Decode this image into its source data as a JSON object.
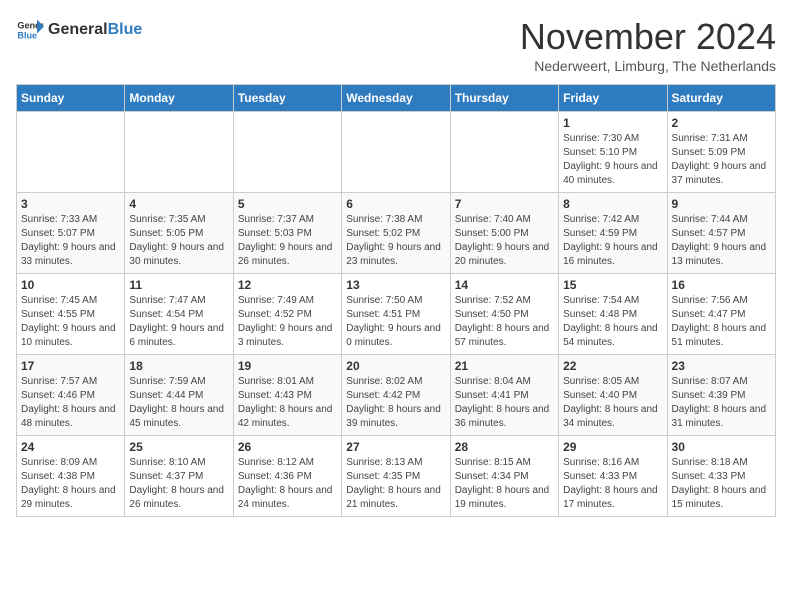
{
  "header": {
    "logo_general": "General",
    "logo_blue": "Blue",
    "month_title": "November 2024",
    "subtitle": "Nederweert, Limburg, The Netherlands"
  },
  "days_of_week": [
    "Sunday",
    "Monday",
    "Tuesday",
    "Wednesday",
    "Thursday",
    "Friday",
    "Saturday"
  ],
  "weeks": [
    [
      {
        "day": "",
        "info": ""
      },
      {
        "day": "",
        "info": ""
      },
      {
        "day": "",
        "info": ""
      },
      {
        "day": "",
        "info": ""
      },
      {
        "day": "",
        "info": ""
      },
      {
        "day": "1",
        "info": "Sunrise: 7:30 AM\nSunset: 5:10 PM\nDaylight: 9 hours and 40 minutes."
      },
      {
        "day": "2",
        "info": "Sunrise: 7:31 AM\nSunset: 5:09 PM\nDaylight: 9 hours and 37 minutes."
      }
    ],
    [
      {
        "day": "3",
        "info": "Sunrise: 7:33 AM\nSunset: 5:07 PM\nDaylight: 9 hours and 33 minutes."
      },
      {
        "day": "4",
        "info": "Sunrise: 7:35 AM\nSunset: 5:05 PM\nDaylight: 9 hours and 30 minutes."
      },
      {
        "day": "5",
        "info": "Sunrise: 7:37 AM\nSunset: 5:03 PM\nDaylight: 9 hours and 26 minutes."
      },
      {
        "day": "6",
        "info": "Sunrise: 7:38 AM\nSunset: 5:02 PM\nDaylight: 9 hours and 23 minutes."
      },
      {
        "day": "7",
        "info": "Sunrise: 7:40 AM\nSunset: 5:00 PM\nDaylight: 9 hours and 20 minutes."
      },
      {
        "day": "8",
        "info": "Sunrise: 7:42 AM\nSunset: 4:59 PM\nDaylight: 9 hours and 16 minutes."
      },
      {
        "day": "9",
        "info": "Sunrise: 7:44 AM\nSunset: 4:57 PM\nDaylight: 9 hours and 13 minutes."
      }
    ],
    [
      {
        "day": "10",
        "info": "Sunrise: 7:45 AM\nSunset: 4:55 PM\nDaylight: 9 hours and 10 minutes."
      },
      {
        "day": "11",
        "info": "Sunrise: 7:47 AM\nSunset: 4:54 PM\nDaylight: 9 hours and 6 minutes."
      },
      {
        "day": "12",
        "info": "Sunrise: 7:49 AM\nSunset: 4:52 PM\nDaylight: 9 hours and 3 minutes."
      },
      {
        "day": "13",
        "info": "Sunrise: 7:50 AM\nSunset: 4:51 PM\nDaylight: 9 hours and 0 minutes."
      },
      {
        "day": "14",
        "info": "Sunrise: 7:52 AM\nSunset: 4:50 PM\nDaylight: 8 hours and 57 minutes."
      },
      {
        "day": "15",
        "info": "Sunrise: 7:54 AM\nSunset: 4:48 PM\nDaylight: 8 hours and 54 minutes."
      },
      {
        "day": "16",
        "info": "Sunrise: 7:56 AM\nSunset: 4:47 PM\nDaylight: 8 hours and 51 minutes."
      }
    ],
    [
      {
        "day": "17",
        "info": "Sunrise: 7:57 AM\nSunset: 4:46 PM\nDaylight: 8 hours and 48 minutes."
      },
      {
        "day": "18",
        "info": "Sunrise: 7:59 AM\nSunset: 4:44 PM\nDaylight: 8 hours and 45 minutes."
      },
      {
        "day": "19",
        "info": "Sunrise: 8:01 AM\nSunset: 4:43 PM\nDaylight: 8 hours and 42 minutes."
      },
      {
        "day": "20",
        "info": "Sunrise: 8:02 AM\nSunset: 4:42 PM\nDaylight: 8 hours and 39 minutes."
      },
      {
        "day": "21",
        "info": "Sunrise: 8:04 AM\nSunset: 4:41 PM\nDaylight: 8 hours and 36 minutes."
      },
      {
        "day": "22",
        "info": "Sunrise: 8:05 AM\nSunset: 4:40 PM\nDaylight: 8 hours and 34 minutes."
      },
      {
        "day": "23",
        "info": "Sunrise: 8:07 AM\nSunset: 4:39 PM\nDaylight: 8 hours and 31 minutes."
      }
    ],
    [
      {
        "day": "24",
        "info": "Sunrise: 8:09 AM\nSunset: 4:38 PM\nDaylight: 8 hours and 29 minutes."
      },
      {
        "day": "25",
        "info": "Sunrise: 8:10 AM\nSunset: 4:37 PM\nDaylight: 8 hours and 26 minutes."
      },
      {
        "day": "26",
        "info": "Sunrise: 8:12 AM\nSunset: 4:36 PM\nDaylight: 8 hours and 24 minutes."
      },
      {
        "day": "27",
        "info": "Sunrise: 8:13 AM\nSunset: 4:35 PM\nDaylight: 8 hours and 21 minutes."
      },
      {
        "day": "28",
        "info": "Sunrise: 8:15 AM\nSunset: 4:34 PM\nDaylight: 8 hours and 19 minutes."
      },
      {
        "day": "29",
        "info": "Sunrise: 8:16 AM\nSunset: 4:33 PM\nDaylight: 8 hours and 17 minutes."
      },
      {
        "day": "30",
        "info": "Sunrise: 8:18 AM\nSunset: 4:33 PM\nDaylight: 8 hours and 15 minutes."
      }
    ]
  ]
}
